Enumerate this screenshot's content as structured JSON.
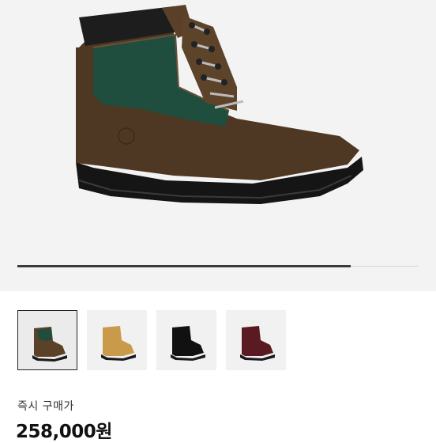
{
  "product": {
    "image_icon": "boot-image",
    "gallery_progress": 0.83
  },
  "thumbnails": [
    {
      "name": "thumbnail-green-brown-boot",
      "color": "#5a4128",
      "selected": true
    },
    {
      "name": "thumbnail-wheat-boot",
      "color": "#c89a4a",
      "selected": false
    },
    {
      "name": "thumbnail-black-boot",
      "color": "#111111",
      "selected": false
    },
    {
      "name": "thumbnail-burgundy-boot",
      "color": "#5a1a22",
      "selected": false
    }
  ],
  "buy": {
    "label": "즉시 구매가",
    "price": "258,000원"
  }
}
